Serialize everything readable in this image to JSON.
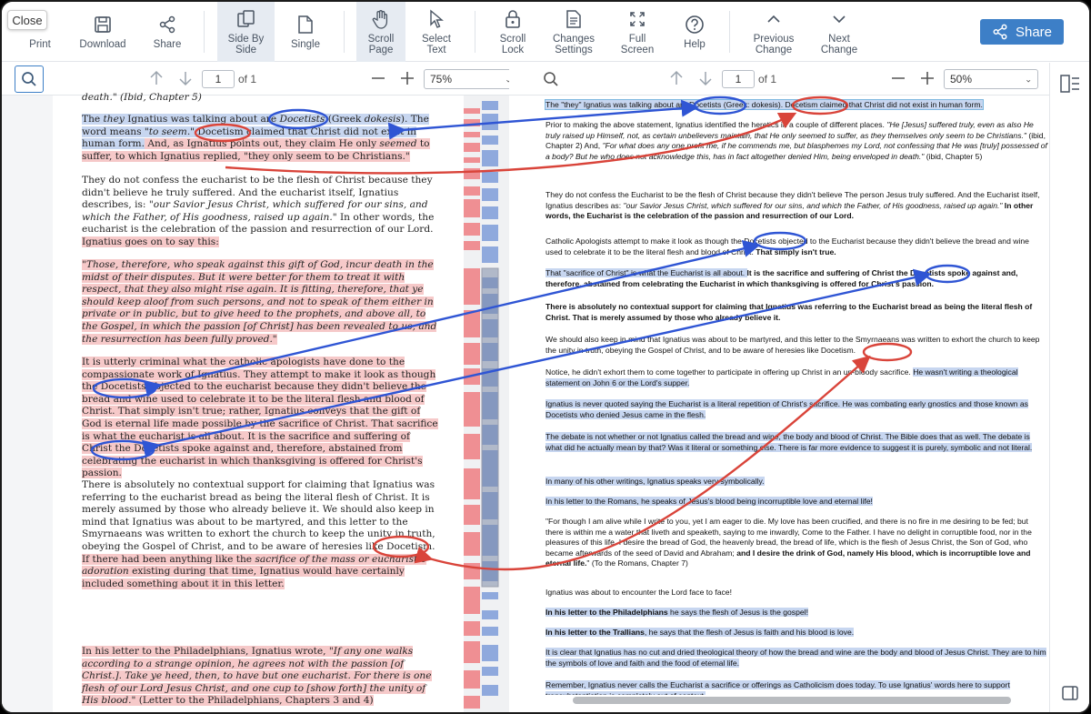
{
  "window": {
    "close_label": "Close"
  },
  "toolbar": {
    "print": "Print",
    "download": "Download",
    "share": "Share",
    "side_by_side": [
      "Side By",
      "Side"
    ],
    "single": "Single",
    "scroll_page": [
      "Scroll",
      "Page"
    ],
    "select_text": [
      "Select",
      "Text"
    ],
    "scroll_lock": [
      "Scroll",
      "Lock"
    ],
    "changes_settings": [
      "Changes",
      "Settings"
    ],
    "full_screen": [
      "Full",
      "Screen"
    ],
    "help": "Help",
    "previous_change": [
      "Previous",
      "Change"
    ],
    "next_change": [
      "Next",
      "Change"
    ],
    "share_button": "Share",
    "accent_color": "#3d7fc7"
  },
  "left_nav": {
    "page": "1",
    "of": "of 1",
    "zoom": "75%"
  },
  "right_nav": {
    "page": "1",
    "of": "of 1",
    "zoom": "50%"
  },
  "left_doc": {
    "p0": "death.\" (Ibid, Chapter 5)",
    "p1a": "The ",
    "p1b": "they",
    "p1c": " Ignatius was talking about are ",
    "p1d": "Docetists",
    "p1e": " (Greek ",
    "p1f": "dokesis",
    "p1g": ").  The word means ",
    "p1h": "\"to seem.\"",
    "p1i": "  Docetism claimed that Christ did not exist in human form.",
    "p1j": "  And, as Ignatius points out, they claim He only ",
    "p1k": "seemed",
    "p1l": " to suffer, to which Ignatius replied, \"they only seem to be Christians.\"",
    "p2": "They do not confess the eucharist to be the flesh of Christ because they didn't believe he truly suffered.  And the eucharist itself, Ignatius describes, is: ",
    "p2i": "\"our Savior Jesus Christ, which suffered for our sins, and which the Father, of His goodness, raised up again.\"",
    "p2b": "  In other words, the eucharist is the celebration of the passion and resurrection of our Lord.",
    "p2c": "Ignatius goes on to say this:",
    "p3": "\"Those, therefore, who speak against this gift of God, incur death in the midst of their disputes. But it were better for them to treat it with respect, that they also might rise again. It is fitting, therefore, that ye should keep aloof from such persons, and not to speak of them either in private or in public, but to give heed to the prophets, and above all, to the Gospel, in which the passion [of Christ] has been revealed to us, and the resurrection has been fully proved.\"",
    "p4": "It is utterly criminal what the catholic apologists have done to the compassionate work of Ignatius.  They attempt to make it look as though the Docetists objected to the eucharist because they didn't believe the bread and wine used to celebrate it to be the literal flesh and blood of Christ.  That simply isn't true; rather, Ignatius conveys that the gift of God is eternal life made possible by the sacrifice of Christ.  That sacrifice is what the eucharist is all about.  It is the sacrifice and suffering of Christ the Docetists spoke against and, therefore, abstained from celebrating the eucharist in which thanksgiving is offered for Christ's passion.",
    "p5a": "There is absolutely no contextual support for claiming that Ignatius was referring to the eucharist bread as being the literal flesh of Christ.  It is merely assumed by those who already believe it.  We should also keep in mind that Ignatius was about to be martyred, and this letter to the Smyrnaeans was written to exhort the church to keep the unity in truth, obeying the Gospel of Christ, and to be aware of heresies like Docetism.",
    "p5b": "If there had been anything like the ",
    "p5c": "sacrifice of the mass or eucharistic adoration",
    "p5d": " existing during that time, Ignatius would have certainly included something about it in this letter.",
    "p6a": "In his letter to the Philadelphians, Ignatius wrote, \"",
    "p6b": "If any one walks according to a strange opinion, he agrees not with the passion [of Christ.].  Take ye heed, then, to have but one eucharist. For there is one flesh of our Lord Jesus Christ, and one cup to [show forth] the unity of His blood.",
    "p6c": "\" (Letter to the Philadelphians, Chapters 3 and 4)"
  },
  "right_doc": {
    "r1": "The \"they\" Ignatius was talking about are Docetists (Greek: dokesis). Docetism claimed that Christ did not exist in human form.",
    "r2a": "Prior to making the above statement, Ignatius identified the heretics in a couple of different places. ",
    "r2b": "\"He [Jesus] suffered truly, even as also He truly raised up Himself, not, as certain unbelievers maintain, that He only seemed to suffer, as they themselves only seem to be Christians.\"",
    "r2c": " (ibid, Chapter 2) And, ",
    "r2d": "\"For what does any one profit me, if he commends me, but blasphemes my Lord, not confessing that He was [truly] possessed of a body? But he who does not acknowledge this, has in fact altogether denied Him, being enveloped in death.\"",
    "r2e": " (ibid, Chapter 5)",
    "r3a": "They do not confess the Eucharist to be the flesh of Christ because they didn't believe The person Jesus truly suffered. And the Eucharist itself, Ignatius describes as: ",
    "r3b": "\"our Savior Jesus Christ, which suffered for our sins, and which the Father, of His goodness, raised up again.\"",
    "r3c": " In other words, the Eucharist is the celebration of the passion and resurrection of our Lord.",
    "r4a": "Catholic Apologists attempt to make it look as though the Docetists objected to the Eucharist because they didn't believe the bread and wine used to celebrate it to be the literal flesh and blood of Christ. ",
    "r4b": "That simply isn't true.",
    "r5a": "That \"sacrifice of Christ\" is what the Eucharist is all about. ",
    "r5b": "It is the sacrifice and suffering of Christ the Docetists spoke against and, therefore, abstained from celebrating the Eucharist in which thanksgiving is offered for Christ's passion.",
    "r6": "There is absolutely no contextual support for claiming that Ignatius was referring to the Eucharist bread as being the literal flesh of Christ. That is merely assumed by those who already believe it.",
    "r7": "We should also keep in mind that Ignatius was about to be martyred, and this letter to the Smyrnaeans was written to exhort the church to keep the unity in truth, obeying the Gospel of Christ, and to be aware of heresies like Docetism.",
    "r8a": "Notice, he didn't exhort them to come together to participate in offering up Christ in an un-bloody sacrifice. ",
    "r8b": "He wasn't writing a theological statement on John 6 or the Lord's supper.",
    "r9": "Ignatius is never quoted saying the Eucharist is a literal repetition of Christ's sacrifice. He was combating early gnostics and those known as Docetists who denied Jesus came in the flesh.",
    "r10": "The debate is not whether or not Ignatius called the bread and wine, the body and blood of Christ. The Bible does that as well. The debate is what did he actually mean by that? Was it literal or something else. There is far more evidence to suggest it is purely, symbolic and not literal.",
    "r11": "In many of his other writings, Ignatius speaks very symbolically.",
    "r12": "In his letter to the Romans, he speaks of Jesus's blood being incorruptible love and eternal life!",
    "r13a": "\"For though I am alive while I write to you, yet I am eager to die. My love has been crucified, and there is no fire in me desiring to be fed; but there is within me a water that liveth and speaketh, saying to me inwardly, Come to the Father. I have no delight in corruptible food, nor in the pleasures of this life. I desire the bread of God, the heavenly bread, the bread of life, which is the flesh of Jesus Christ, the Son of God, who became afterwards of the seed of David and Abraham; ",
    "r13b": "and I desire the drink of God, namely His blood, which is incorruptible love and eternal life.",
    "r13c": "\" (To the Romans, Chapter 7)",
    "r14": "Ignatius was about to encounter the Lord face to face!",
    "r15a": "In his letter to the Philadelphians",
    "r15b": " he says the flesh of Jesus is the gospel!",
    "r16a": "In his letter to the Trallians",
    "r16b": ", he says that the flesh of Jesus is faith and his blood is love.",
    "r17": "It is clear that Ignatius has no cut and dried theological theory of how the bread and wine are the body and blood of Jesus Christ. They are to him the symbols of love and faith and the food of eternal life.",
    "r18": "Remember, Ignatius never calls the Eucharist a sacrifice or offerings as Catholicism does today. To use Ignatius' words here to support transubstantiation is completely out of context."
  },
  "annotation_colors": {
    "blue": "#2f55d4",
    "red": "#d9443a"
  }
}
